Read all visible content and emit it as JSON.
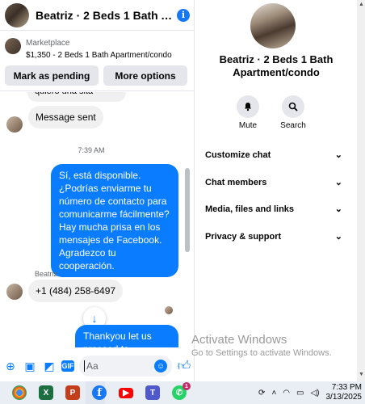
{
  "chat_header": {
    "title": "Beatriz · 2 Beds 1 Bath A...",
    "info_icon": "info-icon"
  },
  "marketplace": {
    "label": "Marketplace",
    "item": "$1,350 - 2 Beds 1 Bath Apartment/condo",
    "pending_button": "Mark as pending",
    "more_button": "More options"
  },
  "messages": {
    "partial_top": "quiero una sita",
    "sent_status": "Message sent",
    "timestamp": "7:39 AM",
    "outgoing_1": "Sí, está disponible. ¿Podrías enviarme tu número de contacto para comunicarme fácilmente? Hay mucha prisa en los mensajes de Facebook. Agradezco tu cooperación.",
    "sender_name": "Beatriz",
    "incoming_phone": "+1 (484) 258-6497",
    "outgoing_2": "Thankyou let us proceed to"
  },
  "composer": {
    "placeholder": "Aa"
  },
  "info_panel": {
    "name": "Beatriz · 2 Beds 1 Bath Apartment/condo",
    "actions": [
      {
        "label": "Mute",
        "icon": "bell-icon"
      },
      {
        "label": "Search",
        "icon": "search-icon"
      }
    ],
    "sections": [
      {
        "label": "Customize chat"
      },
      {
        "label": "Chat members"
      },
      {
        "label": "Media, files and links"
      },
      {
        "label": "Privacy & support"
      }
    ]
  },
  "watermark": {
    "title": "Activate Windows",
    "subtitle": "Go to Settings to activate Windows."
  },
  "taskbar": {
    "apps": [
      "chrome-icon",
      "excel-icon",
      "powerpoint-icon",
      "facebook-icon",
      "youtube-icon",
      "teams-icon",
      "whatsapp-icon"
    ],
    "whatsapp_badge": "1",
    "time": "7:33 PM",
    "date": "3/13/2025"
  },
  "colors": {
    "accent": "#0a7cff",
    "facebook_blue": "#1877f2",
    "bubble_in": "#f0f0f0"
  }
}
